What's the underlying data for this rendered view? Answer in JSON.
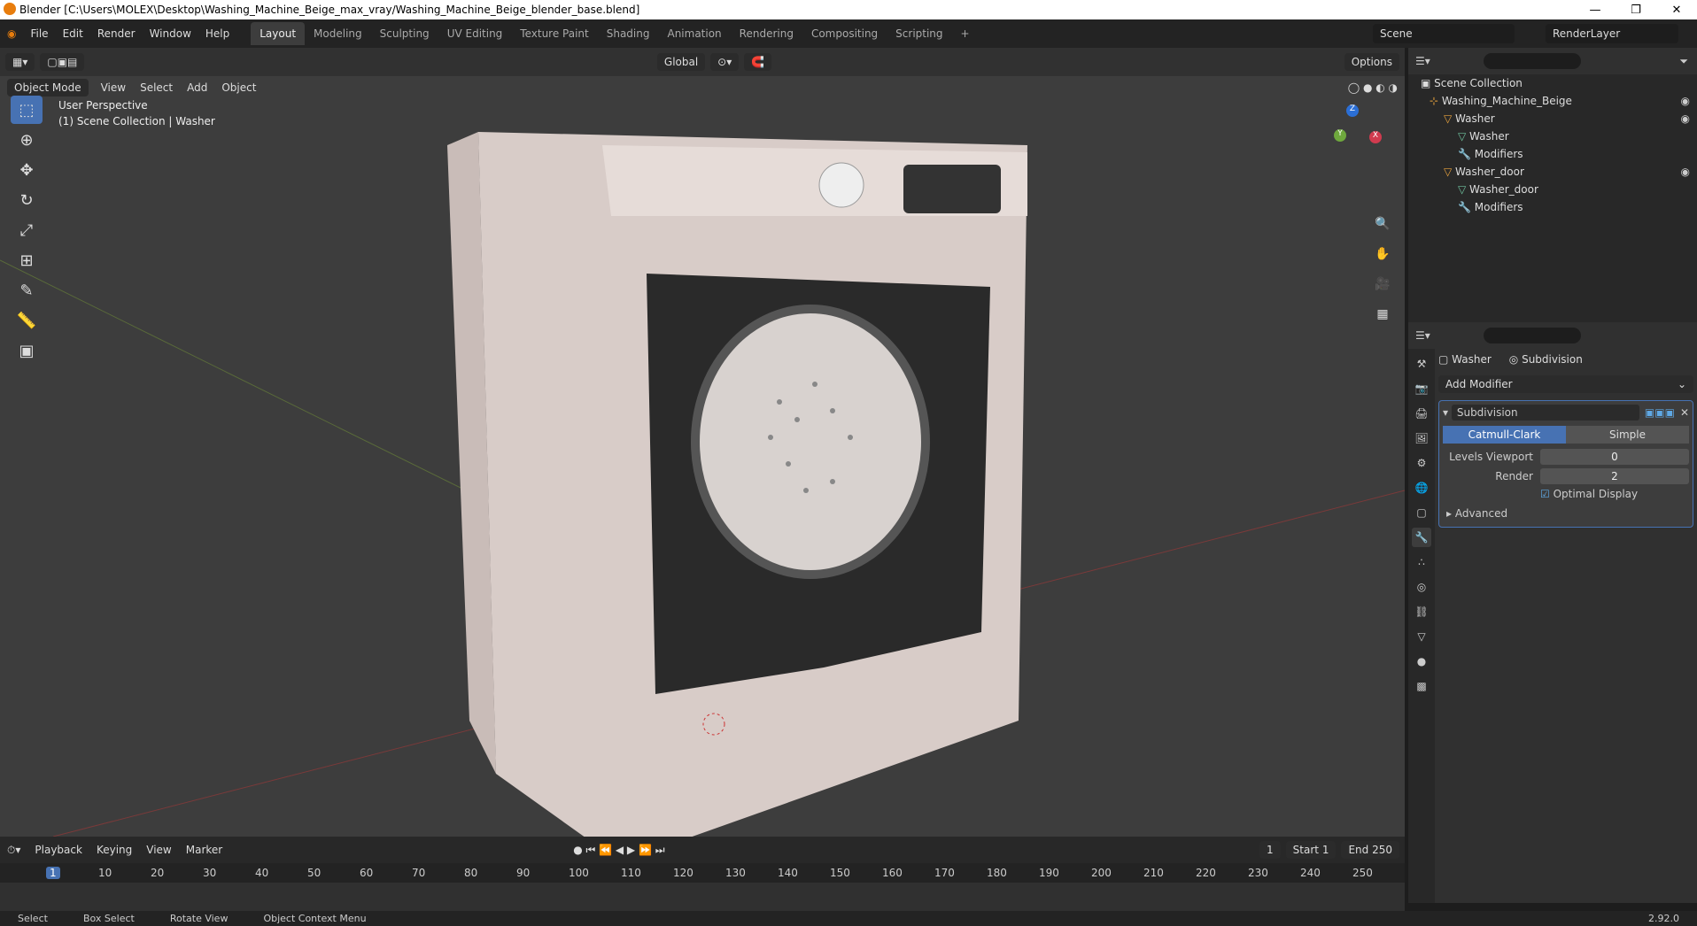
{
  "window": {
    "title": "Blender [C:\\Users\\MOLEX\\Desktop\\Washing_Machine_Beige_max_vray/Washing_Machine_Beige_blender_base.blend]"
  },
  "menu": [
    "File",
    "Edit",
    "Render",
    "Window",
    "Help"
  ],
  "workspaces": [
    "Layout",
    "Modeling",
    "Sculpting",
    "UV Editing",
    "Texture Paint",
    "Shading",
    "Animation",
    "Rendering",
    "Compositing",
    "Scripting"
  ],
  "active_workspace": "Layout",
  "scene": "Scene",
  "render_layer": "RenderLayer",
  "viewport": {
    "mode": "Object Mode",
    "menus": [
      "View",
      "Select",
      "Add",
      "Object"
    ],
    "orientation": "Global",
    "options": "Options",
    "perspective": "User Perspective",
    "collection_info": "(1) Scene Collection | Washer"
  },
  "outliner": {
    "root": "Scene Collection",
    "items": [
      {
        "label": "Washing_Machine_Beige",
        "depth": 1
      },
      {
        "label": "Washer",
        "depth": 2
      },
      {
        "label": "Washer",
        "depth": 3
      },
      {
        "label": "Modifiers",
        "depth": 3
      },
      {
        "label": "Washer_door",
        "depth": 2
      },
      {
        "label": "Washer_door",
        "depth": 3
      },
      {
        "label": "Modifiers",
        "depth": 3
      }
    ]
  },
  "properties": {
    "object": "Washer",
    "modifier_crumb": "Subdivision",
    "add_modifier": "Add Modifier",
    "modifier_name": "Subdivision",
    "algo_a": "Catmull-Clark",
    "algo_b": "Simple",
    "levels_viewport_label": "Levels Viewport",
    "levels_viewport": "0",
    "render_label": "Render",
    "render": "2",
    "optimal_display": "Optimal Display",
    "advanced": "Advanced"
  },
  "timeline": {
    "menus": [
      "Playback",
      "Keying",
      "View",
      "Marker"
    ],
    "current_frame": "1",
    "start_label": "Start",
    "start": "1",
    "end_label": "End",
    "end": "250",
    "ticks": [
      "1",
      "10",
      "20",
      "30",
      "40",
      "50",
      "60",
      "70",
      "80",
      "90",
      "100",
      "110",
      "120",
      "130",
      "140",
      "150",
      "160",
      "170",
      "180",
      "190",
      "200",
      "210",
      "220",
      "230",
      "240",
      "250"
    ]
  },
  "status": {
    "select": "Select",
    "box_select": "Box Select",
    "rotate": "Rotate View",
    "context": "Object Context Menu",
    "version": "2.92.0"
  }
}
